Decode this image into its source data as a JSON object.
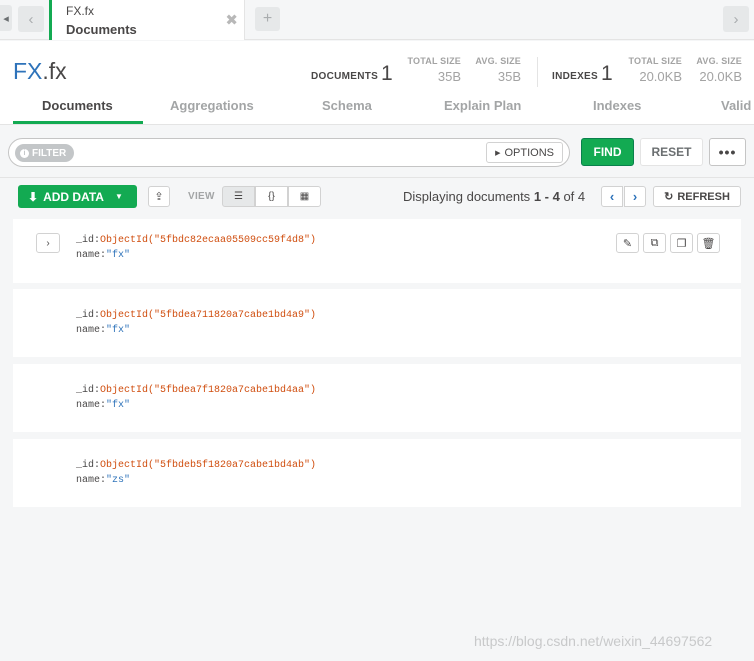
{
  "tabbar": {
    "tab_namespace": "FX.fx",
    "tab_subtitle": "Documents",
    "close_glyph": "✖",
    "add_glyph": "+",
    "back_glyph": "‹",
    "forward_glyph": "›",
    "left_glyph": "◂"
  },
  "header": {
    "db_name": "FX",
    "coll_name": ".fx",
    "documents_label": "DOCUMENTS",
    "documents_count": "1",
    "total_size_label": "TOTAL SIZE",
    "total_size_docs": "35B",
    "avg_size_label": "AVG. SIZE",
    "avg_size_docs": "35B",
    "indexes_label": "INDEXES",
    "indexes_count": "1",
    "total_size_idx": "20.0KB",
    "avg_size_idx": "20.0KB"
  },
  "subtabs": [
    "Documents",
    "Aggregations",
    "Schema",
    "Explain Plan",
    "Indexes",
    "Valid"
  ],
  "query": {
    "filter_badge": "FILTER",
    "filter_value": "",
    "options_label": "OPTIONS",
    "find_label": "FIND",
    "reset_label": "RESET",
    "more_label": "•••"
  },
  "controls": {
    "add_data_label": "ADD DATA",
    "view_label": "VIEW",
    "view_list_glyph": "☰",
    "view_json_glyph": "{}",
    "view_table_glyph": "▦",
    "displaying_prefix": "Displaying documents",
    "range": "1 - 4",
    "of_label": "of",
    "total": "4",
    "refresh_label": "REFRESH"
  },
  "documents": [
    {
      "id_key": "_id:",
      "id_value": "ObjectId(\"5fbdc82ecaa05509cc59f4d8\")",
      "name_key": "name:",
      "name_value": "\"fx\""
    },
    {
      "id_key": "_id:",
      "id_value": "ObjectId(\"5fbdea711820a7cabe1bd4a9\")",
      "name_key": "name:",
      "name_value": "\"fx\""
    },
    {
      "id_key": "_id:",
      "id_value": "ObjectId(\"5fbdea7f1820a7cabe1bd4aa\")",
      "name_key": "name:",
      "name_value": "\"fx\""
    },
    {
      "id_key": "_id:",
      "id_value": "ObjectId(\"5fbdeb5f1820a7cabe1bd4ab\")",
      "name_key": "name:",
      "name_value": "\"zs\""
    }
  ],
  "watermark": "https://blog.csdn.net/weixin_44697562"
}
